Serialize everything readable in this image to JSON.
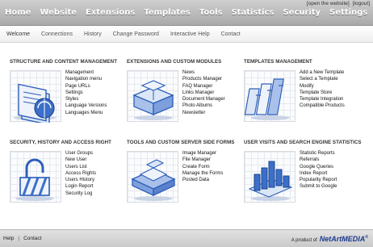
{
  "top_nav": {
    "items": [
      "Home",
      "Website",
      "Extensions",
      "Templates",
      "Tools",
      "Statistics",
      "Security",
      "Settings"
    ],
    "open_website": "[open the website]",
    "logout": "[logout]"
  },
  "sub_nav": {
    "items": [
      "Welcome",
      "Connections",
      "History",
      "Change Password",
      "Interactive Help",
      "Contact"
    ]
  },
  "sections": [
    {
      "title": "STRUCTURE AND CONTENT MANAGEMENT",
      "icon": "content-management-icon",
      "links": [
        "Management",
        "Navigation menu",
        "Page URLs",
        "Settings",
        "Styles",
        "Language Versions",
        "Languages Menu"
      ]
    },
    {
      "title": "EXTENSIONS AND CUSTOM MODULES",
      "icon": "modules-icon",
      "links": [
        "News",
        "Products Manager",
        "FAQ Manager",
        "Links Manager",
        "Document Manager",
        "Photo Albums",
        "Newsletter"
      ]
    },
    {
      "title": "TEMPLATES MANAGEMENT",
      "icon": "templates-icon",
      "links": [
        "Add a New Template",
        "Select a Template",
        "Modify",
        "Template Store",
        "Template Integration",
        "Compatible Products"
      ]
    },
    {
      "title": "SECURITY, HISTORY AND ACCESS RIGHT",
      "icon": "padlock-icon",
      "links": [
        "User Groups",
        "New User",
        "Users List",
        "Access Rights",
        "Users History",
        "Login Report",
        "Security Log"
      ]
    },
    {
      "title": "TOOLS AND CUSTOM SERVER SIDE FORMS",
      "icon": "tools-icon",
      "links": [
        "Image Manager",
        "File Manager",
        "Create Form",
        "Manage the Forms",
        "Posted Data"
      ]
    },
    {
      "title": "USER VISITS AND SEARCH ENGINE STATISTICS",
      "icon": "statistics-icon",
      "links": [
        "Statistic Reports",
        "Referrals",
        "Google Queries",
        "Index Report",
        "Popularity Report",
        "Submit to Google"
      ]
    }
  ],
  "footer": {
    "help": "Help",
    "contact": "Contact",
    "product_of": "A product of",
    "brand": "NetArtMEDIA",
    "registered": "®"
  },
  "colors": {
    "nav_gradient_top": "#cfcfcf",
    "nav_gradient_bottom": "#a9a9a9",
    "icon_blue": "#2d5fb8",
    "brand_blue": "#1b3a8c"
  }
}
